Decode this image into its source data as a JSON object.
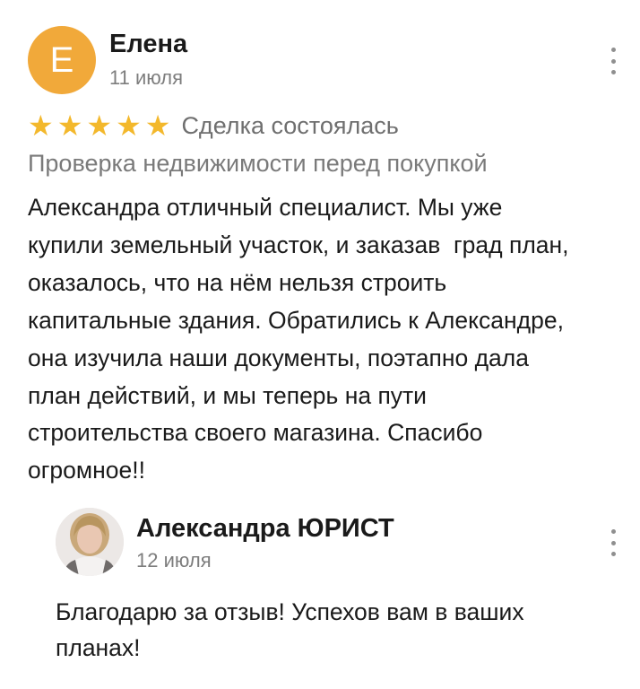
{
  "review": {
    "author_initial": "Е",
    "author_name": "Елена",
    "date": "11 июля",
    "rating": 5,
    "rating_max": 5,
    "deal_status": "Сделка состоялась",
    "service": "Проверка недвижимости перед покупкой",
    "text": "Александра отличный специалист. Мы уже\nкупили земельный участок, и заказав  град план,\nоказалось, что на нём нельзя строить\nкапитальные здания. Обратились к Александре,\nона изучила наши документы, поэтапно дала\nплан действий, и мы теперь на пути\nстроительства своего магазина. Спасибо\nогромное!!"
  },
  "reply": {
    "author_name": "Александра  ЮРИСТ",
    "date": "12 июля",
    "text": "Благодарю за отзыв! Успехов вам в ваших\nпланах!"
  },
  "colors": {
    "avatar_bg": "#f1a93a",
    "star": "#f3b82c",
    "muted_text": "#7d7d7d"
  },
  "icons": {
    "menu": "more-vertical-icon",
    "star": "star-icon"
  }
}
